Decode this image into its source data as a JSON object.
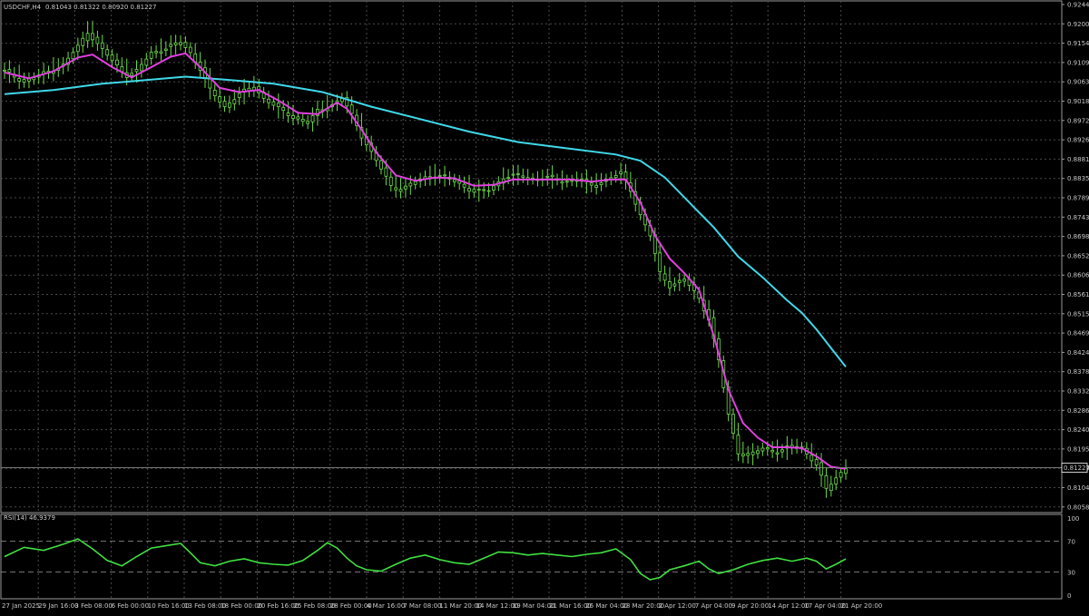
{
  "header": {
    "symbol_info": "USDCHF,H4",
    "ohlc": "0.81043 0.81322 0.80920 0.81227"
  },
  "indicator": {
    "label": "RSI(14) 46.9379",
    "scale_labels": [
      "100",
      "70",
      "30",
      "0"
    ]
  },
  "colors": {
    "background": "#000000",
    "grid": "#4a4a4a",
    "frame": "#9a9a9a",
    "candles": "#6ddc4a",
    "ma_fast": "#e040e0",
    "ma_slow": "#40d8e8",
    "rsi": "#40e040",
    "current_price_tag": "#ffffff"
  },
  "chart_data": {
    "type": "line",
    "price_axis": {
      "ticks": [
        "0.92440",
        "0.92000",
        "0.91540",
        "0.91090",
        "0.90630",
        "0.90180",
        "0.89720",
        "0.89260",
        "0.88810",
        "0.88350",
        "0.87890",
        "0.87430",
        "0.86980",
        "0.86520",
        "0.86060",
        "0.85610",
        "0.85150",
        "0.84690",
        "0.84240",
        "0.83780",
        "0.83320",
        "0.82860",
        "0.82400",
        "0.81950",
        "0.81490",
        "0.81040",
        "0.80580"
      ],
      "range": [
        0.8015,
        0.9244
      ],
      "current_price": 0.81227,
      "current_price_label": "0.81227"
    },
    "time_axis": {
      "labels": [
        "27 Jan 2025",
        "29 Jan 16:00",
        "3 Feb 08:00",
        "6 Feb 00:00",
        "10 Feb 16:00",
        "13 Feb 08:00",
        "18 Feb 00:00",
        "20 Feb 16:00",
        "25 Feb 08:00",
        "28 Feb 00:00",
        "4 Mar 16:00",
        "7 Mar 08:00",
        "11 Mar 20:00",
        "14 Mar 12:00",
        "19 Mar 04:00",
        "21 Mar 16:00",
        "26 Mar 04:00",
        "28 Mar 20:00",
        "2 Apr 12:00",
        "7 Apr 04:00",
        "9 Apr 20:00",
        "14 Apr 12:00",
        "17 Apr 04:00",
        "21 Apr 20:00"
      ]
    },
    "series": [
      {
        "key": "price",
        "points": [
          [
            0,
            0.9075
          ],
          [
            4,
            0.905
          ],
          [
            8,
            0.907
          ],
          [
            12,
            0.909
          ],
          [
            15,
            0.9135
          ],
          [
            17,
            0.917
          ],
          [
            19,
            0.914
          ],
          [
            22,
            0.91
          ],
          [
            25,
            0.9065
          ],
          [
            27,
            0.9075
          ],
          [
            30,
            0.912
          ],
          [
            33,
            0.913
          ],
          [
            36,
            0.9145
          ],
          [
            38,
            0.912
          ],
          [
            40,
            0.908
          ],
          [
            42,
            0.903
          ],
          [
            45,
            0.899
          ],
          [
            48,
            0.902
          ],
          [
            51,
            0.904
          ],
          [
            53,
            0.901
          ],
          [
            56,
            0.8985
          ],
          [
            59,
            0.8965
          ],
          [
            62,
            0.895
          ],
          [
            64,
            0.898
          ],
          [
            67,
            0.8995
          ],
          [
            69,
            0.901
          ],
          [
            71,
            0.897
          ],
          [
            73,
            0.892
          ],
          [
            75,
            0.888
          ],
          [
            77,
            0.884
          ],
          [
            79,
            0.88
          ],
          [
            81,
            0.879
          ],
          [
            84,
            0.881
          ],
          [
            87,
            0.8825
          ],
          [
            90,
            0.882
          ],
          [
            93,
            0.8805
          ],
          [
            96,
            0.8785
          ],
          [
            99,
            0.879
          ],
          [
            102,
            0.882
          ],
          [
            105,
            0.8825
          ],
          [
            108,
            0.8815
          ],
          [
            111,
            0.882
          ],
          [
            114,
            0.881
          ],
          [
            117,
            0.8815
          ],
          [
            120,
            0.88
          ],
          [
            123,
            0.8815
          ],
          [
            126,
            0.883
          ],
          [
            128,
            0.879
          ],
          [
            130,
            0.873
          ],
          [
            132,
            0.868
          ],
          [
            134,
            0.859
          ],
          [
            136,
            0.856
          ],
          [
            139,
            0.8575
          ],
          [
            142,
            0.853
          ],
          [
            144,
            0.848
          ],
          [
            146,
            0.838
          ],
          [
            148,
            0.825
          ],
          [
            150,
            0.816
          ],
          [
            152,
            0.815
          ],
          [
            155,
            0.817
          ],
          [
            158,
            0.816
          ],
          [
            161,
            0.8175
          ],
          [
            163,
            0.817
          ],
          [
            166,
            0.813
          ],
          [
            168,
            0.807
          ],
          [
            170,
            0.81
          ],
          [
            172,
            0.8123
          ]
        ]
      },
      {
        "key": "ma_fast",
        "points": [
          [
            0,
            0.9072
          ],
          [
            5,
            0.9058
          ],
          [
            10,
            0.9075
          ],
          [
            15,
            0.9108
          ],
          [
            18,
            0.9115
          ],
          [
            22,
            0.9085
          ],
          [
            26,
            0.906
          ],
          [
            30,
            0.9085
          ],
          [
            34,
            0.911
          ],
          [
            37,
            0.9118
          ],
          [
            40,
            0.9085
          ],
          [
            44,
            0.9035
          ],
          [
            48,
            0.9025
          ],
          [
            52,
            0.903
          ],
          [
            56,
            0.9005
          ],
          [
            60,
            0.8975
          ],
          [
            64,
            0.8972
          ],
          [
            68,
            0.9
          ],
          [
            70,
            0.8985
          ],
          [
            73,
            0.8935
          ],
          [
            76,
            0.888
          ],
          [
            80,
            0.8825
          ],
          [
            84,
            0.8812
          ],
          [
            88,
            0.882
          ],
          [
            92,
            0.8818
          ],
          [
            96,
            0.88
          ],
          [
            100,
            0.8802
          ],
          [
            104,
            0.8815
          ],
          [
            108,
            0.8815
          ],
          [
            112,
            0.8815
          ],
          [
            116,
            0.8815
          ],
          [
            120,
            0.881
          ],
          [
            124,
            0.8815
          ],
          [
            127,
            0.8815
          ],
          [
            130,
            0.876
          ],
          [
            133,
            0.868
          ],
          [
            136,
            0.8625
          ],
          [
            139,
            0.859
          ],
          [
            142,
            0.855
          ],
          [
            145,
            0.844
          ],
          [
            148,
            0.831
          ],
          [
            151,
            0.823
          ],
          [
            154,
            0.8195
          ],
          [
            157,
            0.8172
          ],
          [
            160,
            0.8172
          ],
          [
            163,
            0.817
          ],
          [
            166,
            0.815
          ],
          [
            169,
            0.8125
          ],
          [
            172,
            0.812
          ]
        ]
      },
      {
        "key": "ma_slow",
        "points": [
          [
            0,
            0.902
          ],
          [
            10,
            0.903
          ],
          [
            20,
            0.9045
          ],
          [
            30,
            0.9055
          ],
          [
            37,
            0.9062
          ],
          [
            45,
            0.9055
          ],
          [
            55,
            0.9045
          ],
          [
            65,
            0.9025
          ],
          [
            75,
            0.899
          ],
          [
            85,
            0.896
          ],
          [
            95,
            0.893
          ],
          [
            105,
            0.8905
          ],
          [
            115,
            0.889
          ],
          [
            125,
            0.8875
          ],
          [
            130,
            0.886
          ],
          [
            135,
            0.882
          ],
          [
            140,
            0.876
          ],
          [
            145,
            0.87
          ],
          [
            150,
            0.863
          ],
          [
            155,
            0.858
          ],
          [
            160,
            0.8525
          ],
          [
            163,
            0.8495
          ],
          [
            166,
            0.8455
          ],
          [
            169,
            0.841
          ],
          [
            172,
            0.8365
          ]
        ]
      }
    ],
    "rsi": {
      "range": [
        0,
        100
      ],
      "levels": [
        70,
        30
      ],
      "points": [
        [
          0,
          50
        ],
        [
          4,
          62
        ],
        [
          8,
          58
        ],
        [
          12,
          66
        ],
        [
          15,
          73
        ],
        [
          18,
          60
        ],
        [
          21,
          45
        ],
        [
          24,
          38
        ],
        [
          27,
          50
        ],
        [
          30,
          61
        ],
        [
          33,
          64
        ],
        [
          36,
          67
        ],
        [
          38,
          55
        ],
        [
          40,
          42
        ],
        [
          43,
          38
        ],
        [
          46,
          44
        ],
        [
          49,
          47
        ],
        [
          52,
          42
        ],
        [
          55,
          40
        ],
        [
          58,
          39
        ],
        [
          61,
          45
        ],
        [
          64,
          58
        ],
        [
          66,
          68
        ],
        [
          68,
          61
        ],
        [
          70,
          48
        ],
        [
          72,
          38
        ],
        [
          74,
          33
        ],
        [
          77,
          31
        ],
        [
          80,
          40
        ],
        [
          83,
          48
        ],
        [
          86,
          52
        ],
        [
          89,
          46
        ],
        [
          92,
          42
        ],
        [
          95,
          40
        ],
        [
          98,
          48
        ],
        [
          101,
          56
        ],
        [
          104,
          55
        ],
        [
          107,
          52
        ],
        [
          110,
          54
        ],
        [
          113,
          52
        ],
        [
          116,
          50
        ],
        [
          119,
          53
        ],
        [
          122,
          55
        ],
        [
          125,
          60
        ],
        [
          128,
          46
        ],
        [
          130,
          28
        ],
        [
          132,
          20
        ],
        [
          134,
          23
        ],
        [
          136,
          33
        ],
        [
          139,
          38
        ],
        [
          142,
          44
        ],
        [
          144,
          34
        ],
        [
          146,
          28
        ],
        [
          149,
          33
        ],
        [
          152,
          40
        ],
        [
          155,
          45
        ],
        [
          158,
          48
        ],
        [
          161,
          44
        ],
        [
          164,
          48
        ],
        [
          166,
          44
        ],
        [
          168,
          34
        ],
        [
          170,
          40
        ],
        [
          172,
          46.94
        ]
      ]
    }
  }
}
